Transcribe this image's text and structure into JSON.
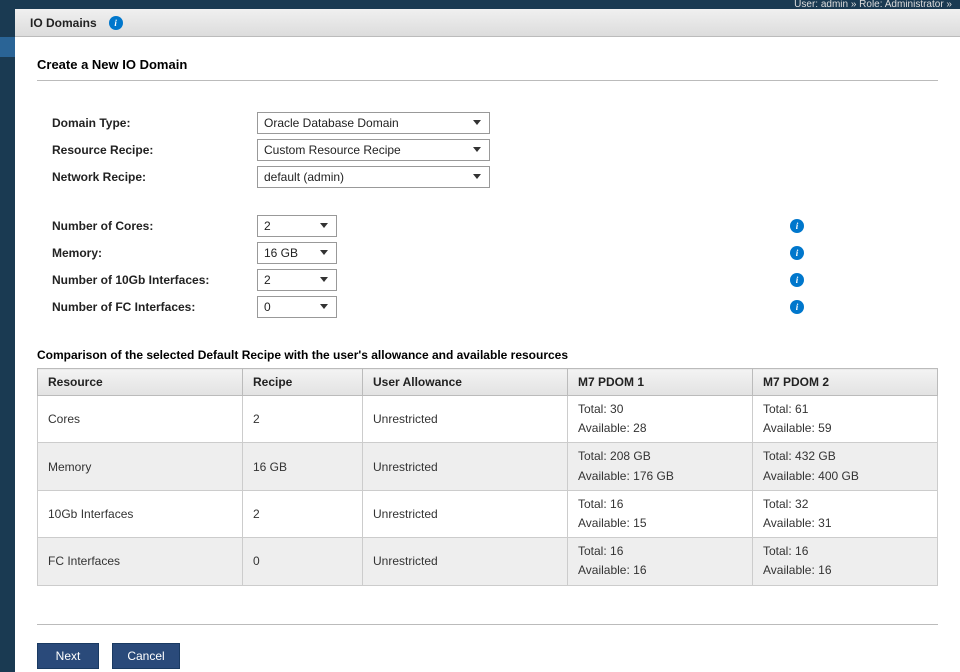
{
  "topstrip": "User: admin » Role: Administrator »",
  "titlebar": {
    "title": "IO Domains"
  },
  "page": {
    "title": "Create a New IO Domain"
  },
  "form": {
    "domain_type": {
      "label": "Domain Type:",
      "value": "Oracle Database Domain"
    },
    "resource_recipe": {
      "label": "Resource Recipe:",
      "value": "Custom Resource Recipe"
    },
    "network_recipe": {
      "label": "Network Recipe:",
      "value": "default (admin)"
    },
    "cores": {
      "label": "Number of Cores:",
      "value": "2"
    },
    "memory": {
      "label": "Memory:",
      "value": "16 GB"
    },
    "tengb": {
      "label": "Number of 10Gb Interfaces:",
      "value": "2"
    },
    "fc": {
      "label": "Number of FC Interfaces:",
      "value": "0"
    }
  },
  "comparison": {
    "title": "Comparison of the selected Default Recipe with the user's allowance and available resources",
    "headers": [
      "Resource",
      "Recipe",
      "User Allowance",
      "M7 PDOM 1",
      "M7 PDOM 2"
    ],
    "rows": [
      {
        "resource": "Cores",
        "recipe": "2",
        "allowance": "Unrestricted",
        "pdom1": {
          "total": "Total: 30",
          "avail": "Available: 28"
        },
        "pdom2": {
          "total": "Total: 61",
          "avail": "Available: 59"
        }
      },
      {
        "resource": "Memory",
        "recipe": "16 GB",
        "allowance": "Unrestricted",
        "pdom1": {
          "total": "Total: 208 GB",
          "avail": "Available: 176 GB"
        },
        "pdom2": {
          "total": "Total: 432 GB",
          "avail": "Available: 400 GB"
        }
      },
      {
        "resource": "10Gb Interfaces",
        "recipe": "2",
        "allowance": "Unrestricted",
        "pdom1": {
          "total": "Total: 16",
          "avail": "Available: 15"
        },
        "pdom2": {
          "total": "Total: 32",
          "avail": "Available: 31"
        }
      },
      {
        "resource": "FC Interfaces",
        "recipe": "0",
        "allowance": "Unrestricted",
        "pdom1": {
          "total": "Total: 16",
          "avail": "Available: 16"
        },
        "pdom2": {
          "total": "Total: 16",
          "avail": "Available: 16"
        }
      }
    ]
  },
  "buttons": {
    "next": "Next",
    "cancel": "Cancel"
  }
}
